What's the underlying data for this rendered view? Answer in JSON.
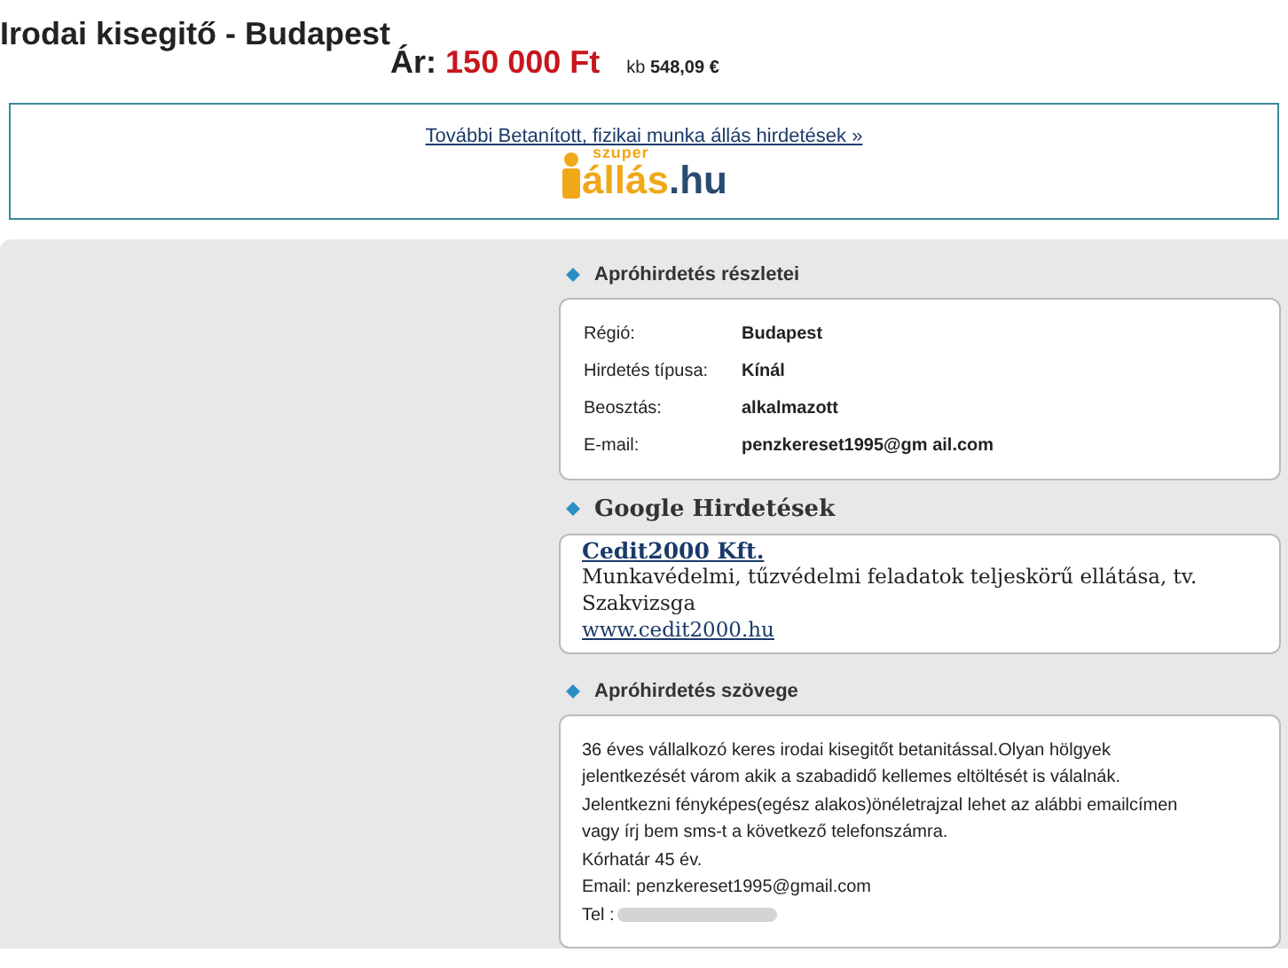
{
  "title": "Irodai kisegitő - Budapest",
  "price": {
    "label": "Ár:",
    "value": "150 000 Ft",
    "approx_label": "kb",
    "approx_value": "548,09 €"
  },
  "banner": {
    "link": "További Betanított, fizikai munka állás hirdetések »",
    "logo": {
      "top": "szuper",
      "main": "állás",
      "suffix": ".hu"
    }
  },
  "details": {
    "heading": "Apróhirdetés részletei",
    "rows": [
      {
        "label": "Régió:",
        "value": "Budapest"
      },
      {
        "label": "Hirdetés típusa:",
        "value": "Kínál"
      },
      {
        "label": "Beosztás:",
        "value": "alkalmazott"
      },
      {
        "label": "E-mail:",
        "value": "penzkereset1995@gm ail.com"
      }
    ]
  },
  "google_ads": {
    "heading": "Google Hirdetések",
    "ad": {
      "title": "Cedit2000 Kft.",
      "text": "Munkavédelmi, tűzvédelmi feladatok teljeskörű ellátása, tv. Szakvizsga",
      "url": "www.cedit2000.hu"
    }
  },
  "ad_text": {
    "heading": "Apróhirdetés szövege",
    "lines": [
      "36 éves vállalkozó keres irodai kisegitőt betanitással.Olyan hölgyek",
      "jelentkezését várom akik a szabadidő kellemes eltöltését is válalnák.",
      "Jelentkezni fényképes(egész alakos)önéletrajzal lehet az alábbi emailcímen",
      "vagy írj bem sms-t a következő telefonszámra.",
      "Kórhatár 45 év.",
      "Email: penzkereset1995@gmail.com",
      "Tel :"
    ],
    "redacted_after_last": true
  }
}
